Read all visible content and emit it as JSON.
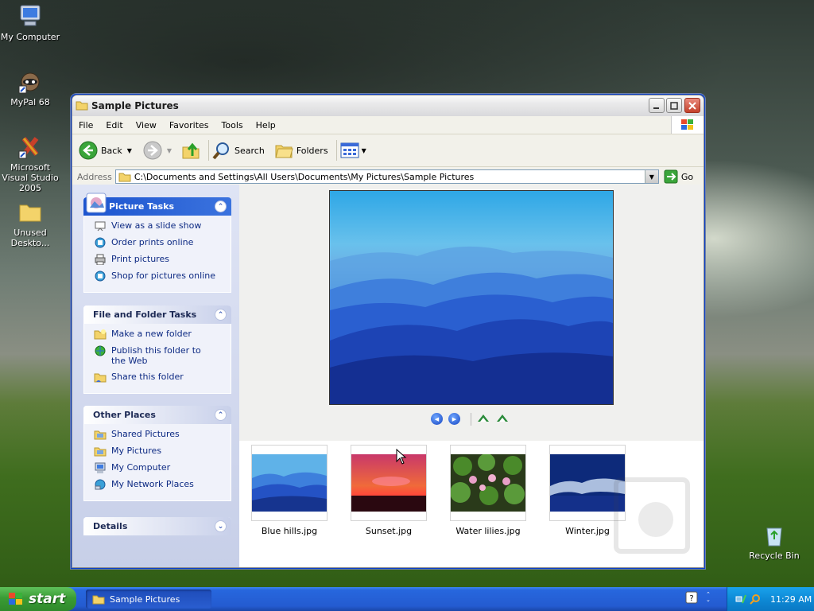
{
  "desktop": {
    "icons": [
      {
        "label": "My Computer"
      },
      {
        "label": "MyPal 68"
      },
      {
        "label": "Microsoft Visual Studio 2005"
      },
      {
        "label": "Unused Deskto..."
      },
      {
        "label": "Recycle Bin"
      }
    ]
  },
  "window": {
    "title": "Sample Pictures",
    "menu": [
      "File",
      "Edit",
      "View",
      "Favorites",
      "Tools",
      "Help"
    ],
    "toolbar": {
      "back_label": "Back",
      "search_label": "Search",
      "folders_label": "Folders"
    },
    "address": {
      "label": "Address",
      "value": "C:\\Documents and Settings\\All Users\\Documents\\My Pictures\\Sample Pictures",
      "go_label": "Go"
    },
    "left_pane": {
      "picture_tasks": {
        "title": "Picture Tasks",
        "items": [
          "View as a slide show",
          "Order prints online",
          "Print pictures",
          "Shop for pictures online"
        ]
      },
      "file_folder_tasks": {
        "title": "File and Folder Tasks",
        "items": [
          "Make a new folder",
          "Publish this folder to the Web",
          "Share this folder"
        ]
      },
      "other_places": {
        "title": "Other Places",
        "items": [
          "Shared Pictures",
          "My Pictures",
          "My Computer",
          "My Network Places"
        ]
      },
      "details": {
        "title": "Details"
      }
    },
    "files": [
      {
        "name": "Blue hills.jpg"
      },
      {
        "name": "Sunset.jpg"
      },
      {
        "name": "Water lilies.jpg"
      },
      {
        "name": "Winter.jpg"
      }
    ]
  },
  "taskbar": {
    "start_label": "start",
    "task_item_label": "Sample Pictures",
    "clock": "11:29 AM"
  },
  "colors": {
    "taskbar_blue": "#245bd0",
    "start_green": "#3a9b35",
    "link_blue": "#0d2a83",
    "panel_header_blue": "#1c54cf"
  }
}
